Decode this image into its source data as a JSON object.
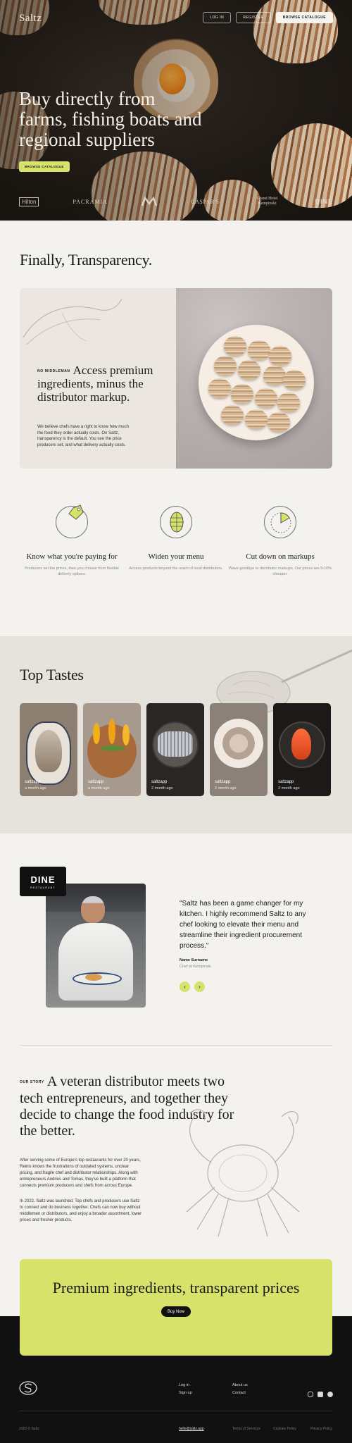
{
  "header": {
    "logo": "Saltz",
    "login_label": "LOG IN",
    "register_label": "REGISTER",
    "browse_label": "BROWSE CATALOGUE"
  },
  "hero": {
    "title": "Buy directly from farms, fishing boats and regional suppliers",
    "cta_label": "BROWSE CATALOGUE",
    "partners": [
      "Hilton",
      "PACRAMIA",
      "Marriott",
      "GASPAR'S",
      "Grand Hotel Kempinski",
      "DINE"
    ]
  },
  "transparency": {
    "title": "Finally, Transparency.",
    "eyebrow": "NO MIDDLEMAN",
    "heading": "Access premium ingredients, minus the distributor markup.",
    "body": "We believe chefs have a right to know how much the food they order actually costs. On Saltz, transparency is the default. You see the price producers set, and what delivery actually costs."
  },
  "benefits": [
    {
      "icon": "price-tag-icon",
      "title": "Know what you're paying for",
      "text": "Producers set the prices, then you choose from flexible delivery options."
    },
    {
      "icon": "globe-icon",
      "title": "Widen your menu",
      "text": "Access products beyond the reach of local distributors."
    },
    {
      "icon": "pie-chart-icon",
      "title": "Cut down on markups",
      "text": "Wave goodbye to distributor markups. Our prices are 5-10% cheaper."
    }
  ],
  "top_tastes": {
    "title": "Top Tastes",
    "cards": [
      {
        "source": "saltzapp",
        "time": "a month ago"
      },
      {
        "source": "saltzapp",
        "time": "a month ago"
      },
      {
        "source": "saltzapp",
        "time": "2 month ago"
      },
      {
        "source": "saltzapp",
        "time": "2 month ago"
      },
      {
        "source": "saltzapp",
        "time": "2 month ago"
      }
    ]
  },
  "testimonial": {
    "brand": "DINE",
    "brand_sub": "RESTAURANT",
    "quote": "\"Saltz has been a game changer for my kitchen. I highly recommend Saltz to any chef looking to elevate their menu and streamline their ingredient procurement process.\"",
    "name": "Name Surname",
    "role": "Chef at Kempinski",
    "prev": "‹",
    "next": "›"
  },
  "story": {
    "eyebrow": "OUR STORY",
    "title": "A veteran distributor meets two tech entrepreneurs, and together they decide to change the food industry for the better.",
    "p1": "After serving some of Europe's top restaurants for over 20 years, Reinis knows the frustrations of outdated systems, unclear pricing, and fragile chef and distributor relationships. Along with entrepreneurs Andrius and Tomas, they've built a platform that connects premium producers and chefs from across Europe.",
    "p2": "In 2022, Saltz was launched. Top chefs and producers use Saltz to connect and do business together. Chefs can now buy without middlemen or distributors, and enjoy a broader assortment, lower prices and fresher products."
  },
  "cta": {
    "title": "Premium ingredients, transparent prices",
    "button": "Buy Now"
  },
  "footer": {
    "links_col1": [
      "Log in",
      "Sign up"
    ],
    "links_col2": [
      "About us",
      "Contact"
    ],
    "copyright": "2022 © Saltz",
    "email": "hello@saltz.app",
    "terms": "Terms of Services",
    "cookies": "Cookies Policy",
    "privacy": "Privacy Policy"
  },
  "colors": {
    "accent": "#d6e26a",
    "dark": "#111111",
    "background": "#f4f2ee"
  }
}
